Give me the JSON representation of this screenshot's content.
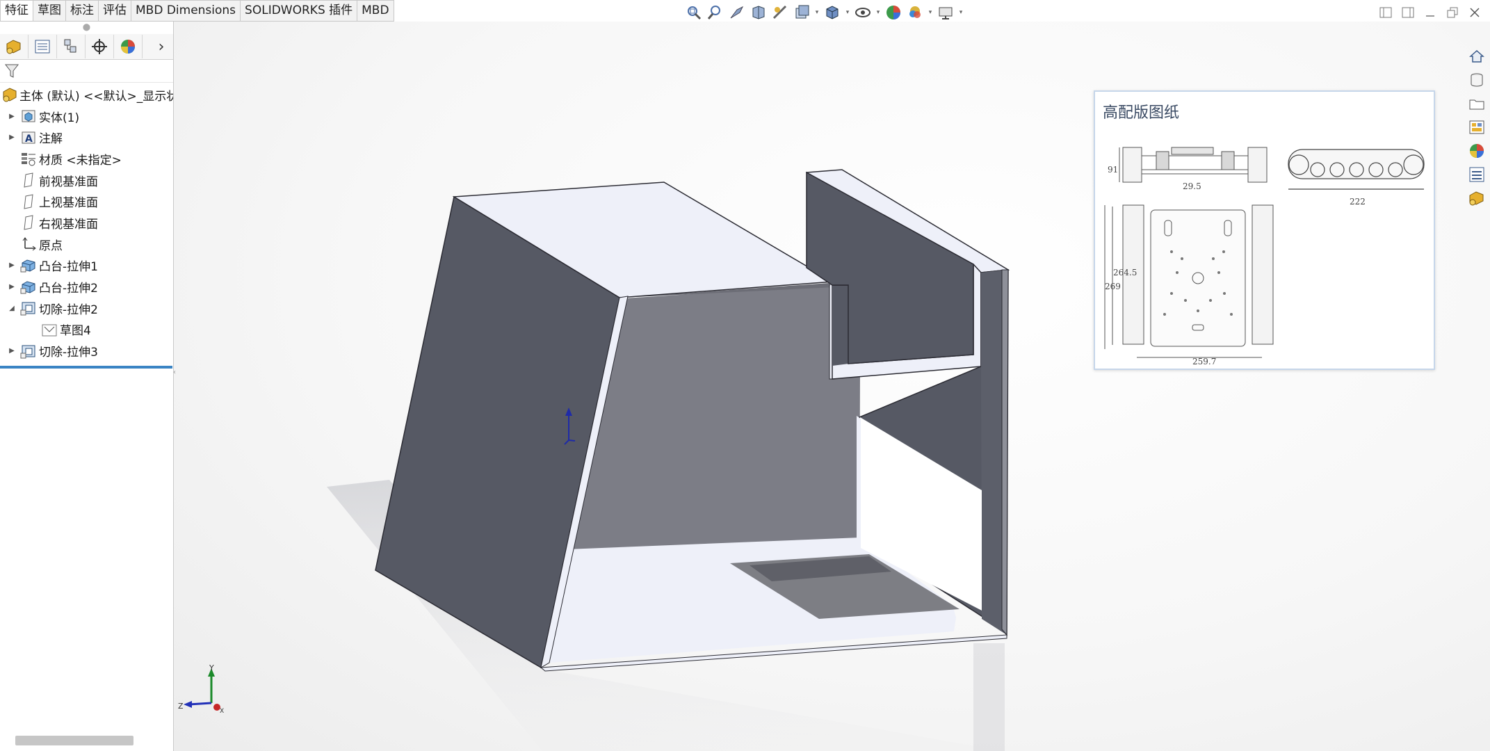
{
  "command_tabs": [
    {
      "label": "特征",
      "active": true
    },
    {
      "label": "草图",
      "active": false
    },
    {
      "label": "标注",
      "active": false
    },
    {
      "label": "评估",
      "active": false
    },
    {
      "label": "MBD Dimensions",
      "active": false
    },
    {
      "label": "SOLIDWORKS 插件",
      "active": false
    },
    {
      "label": "MBD",
      "active": false
    }
  ],
  "view_toolbar_icons": [
    "zoom-to-fit-icon",
    "zoom-to-area-icon",
    "previous-view-icon",
    "section-view-icon",
    "dynamic-annotation-icon",
    "view-orientation-icon",
    "display-style-icon",
    "hide-show-icon",
    "edit-appearance-icon",
    "apply-scene-icon",
    "view-settings-icon"
  ],
  "panel_tabs": [
    "featuremanager-icon",
    "propertymanager-icon",
    "configurationmanager-icon",
    "dimxpertmanager-icon",
    "displaymanager-icon"
  ],
  "feature_tree": {
    "root": "主体 (默认) <<默认>_显示状",
    "items": [
      {
        "label": "实体(1)",
        "icon": "solid-bodies-icon",
        "expander": "collapsed"
      },
      {
        "label": "注解",
        "icon": "annotations-icon",
        "expander": "collapsed"
      },
      {
        "label": "材质 <未指定>",
        "icon": "material-icon",
        "expander": "none"
      },
      {
        "label": "前视基准面",
        "icon": "plane-icon",
        "expander": "none"
      },
      {
        "label": "上视基准面",
        "icon": "plane-icon",
        "expander": "none"
      },
      {
        "label": "右视基准面",
        "icon": "plane-icon",
        "expander": "none"
      },
      {
        "label": "原点",
        "icon": "origin-icon",
        "expander": "none"
      },
      {
        "label": "凸台-拉伸1",
        "icon": "boss-extrude-icon",
        "expander": "collapsed"
      },
      {
        "label": "凸台-拉伸2",
        "icon": "boss-extrude-icon",
        "expander": "collapsed"
      },
      {
        "label": "切除-拉伸2",
        "icon": "cut-extrude-icon",
        "expander": "expanded"
      },
      {
        "label": "草图4",
        "icon": "sketch-icon",
        "expander": "none",
        "child": true
      },
      {
        "label": "切除-拉伸3",
        "icon": "cut-extrude-icon",
        "expander": "collapsed"
      }
    ]
  },
  "task_pane_icons": [
    "home-icon",
    "design-library-icon",
    "file-explorer-icon",
    "view-palette-icon",
    "appearances-icon",
    "custom-properties-icon",
    "3d-content-icon"
  ],
  "reference_image": {
    "title": "高配版图纸",
    "dims": {
      "d91": "91",
      "d295": "29.5",
      "d222": "222",
      "d2645": "264.5",
      "d269": "269",
      "d2597": "259.7"
    }
  },
  "triad": {
    "y": "Y",
    "z": "Z",
    "x": "X"
  },
  "colors": {
    "face_light": "#eef0f9",
    "face_dark": "#565964",
    "face_mid": "#7c7d86",
    "edge": "#2b2b33",
    "rollback_bar": "#3a84c4"
  }
}
